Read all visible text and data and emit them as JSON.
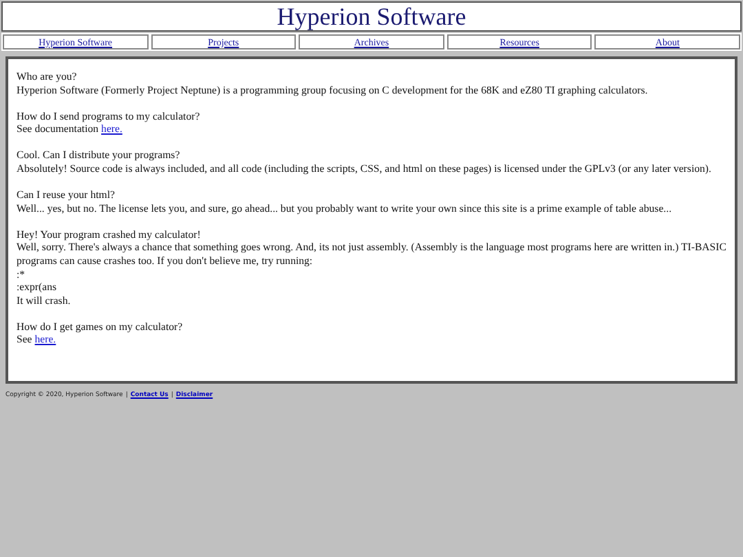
{
  "header": {
    "title": "Hyperion Software"
  },
  "nav": [
    {
      "label": "Hyperion Software"
    },
    {
      "label": "Projects"
    },
    {
      "label": "Archives"
    },
    {
      "label": "Resources"
    },
    {
      "label": "About"
    }
  ],
  "faq": [
    {
      "question": "Who are you?",
      "answer": [
        {
          "text": "Hyperion Software (Formerly Project Neptune) is a programming group focusing on C development for the 68K and eZ80 TI graphing calculators."
        }
      ]
    },
    {
      "question": "How do I send programs to my calculator?",
      "answer": [
        {
          "text": "See documentation",
          "link": "here."
        }
      ]
    },
    {
      "question": "Cool. Can I distribute your programs?",
      "answer": [
        {
          "text": "Absolutely! Source code is always included, and all code (including the scripts, CSS, and html on these pages) is licensed under the GPLv3 (or any later version)."
        }
      ]
    },
    {
      "question": "Can I reuse your html?",
      "answer": [
        {
          "text": "Well... yes, but no. The license lets you, and sure, go ahead... but you probably want to write your own since this site is a prime example of table abuse..."
        }
      ]
    },
    {
      "question": "Hey! Your program crashed my calculator!",
      "answer": [
        {
          "text": "Well, sorry. There's always a chance that something goes wrong. And, its not just assembly. (Assembly is the language most programs here are written in.) TI-BASIC programs can cause crashes too. If you don't believe me, try running:"
        },
        {
          "text": ":*"
        },
        {
          "text": ":expr(ans"
        },
        {
          "text": "It will crash."
        }
      ]
    },
    {
      "question": "How do I get games on my calculator?",
      "answer": [
        {
          "text": "See",
          "link": "here."
        }
      ]
    }
  ],
  "footer": {
    "text": "Copyright © 2020, Hyperion Software",
    "separator": "|",
    "links": [
      "Contact Us",
      "Disclaimer"
    ]
  }
}
